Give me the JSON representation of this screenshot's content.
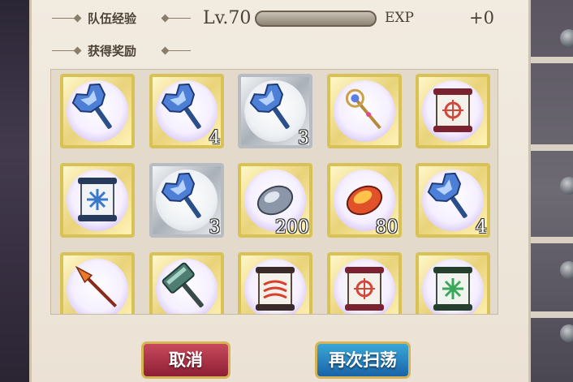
{
  "team_exp": {
    "title": "队伍经验",
    "level": "Lv.70",
    "progress": 0.0,
    "exp_label": "EXP",
    "gain": "+0"
  },
  "rewards": {
    "title": "获得奖励",
    "items": [
      {
        "icon": "crystal-hammer-icon",
        "count": "",
        "frame": "gold"
      },
      {
        "icon": "crystal-hammer-icon",
        "count": "4",
        "frame": "gold"
      },
      {
        "icon": "crystal-hammer-icon",
        "count": "3",
        "frame": "silver"
      },
      {
        "icon": "jeweled-staff-icon",
        "count": "",
        "frame": "gold"
      },
      {
        "icon": "red-scroll-icon",
        "count": "",
        "frame": "gold"
      },
      {
        "icon": "blue-scroll-icon",
        "count": "",
        "frame": "gold"
      },
      {
        "icon": "crystal-hammer-icon",
        "count": "3",
        "frame": "silver"
      },
      {
        "icon": "silver-ore-icon",
        "count": "200",
        "frame": "gold"
      },
      {
        "icon": "fire-ore-icon",
        "count": "80",
        "frame": "gold"
      },
      {
        "icon": "crystal-hammer-icon",
        "count": "4",
        "frame": "gold"
      },
      {
        "icon": "flame-spear-icon",
        "count": "",
        "frame": "gold"
      },
      {
        "icon": "war-hammer-icon",
        "count": "",
        "frame": "gold"
      },
      {
        "icon": "red-swirl-scroll-icon",
        "count": "",
        "frame": "gold"
      },
      {
        "icon": "red-scroll-icon",
        "count": "",
        "frame": "gold"
      },
      {
        "icon": "green-scroll-icon",
        "count": "",
        "frame": "gold"
      }
    ]
  },
  "buttons": {
    "cancel": "取消",
    "again": "再次扫荡"
  }
}
